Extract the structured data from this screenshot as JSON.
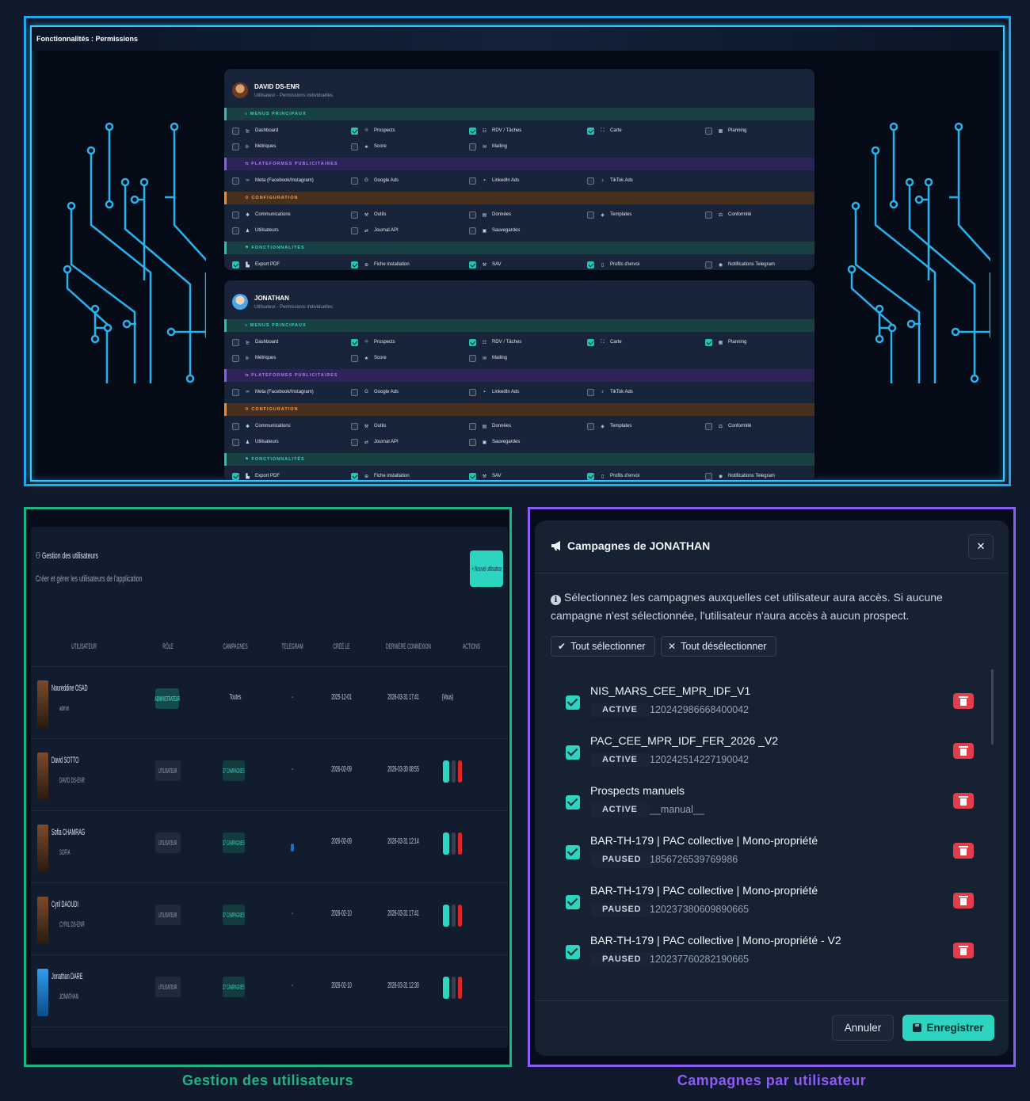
{
  "top": {
    "title": "Fonctionnalités : Permissions",
    "cards": [
      {
        "name": "DAVID DS-ENR",
        "subtitle": "Utilisateur - Permissions individuelles",
        "sections": [
          {
            "label": "≡  MENUS PRINCIPAUX",
            "color": "teal",
            "rows": [
              [
                {
                  "icon": "⊵",
                  "label": "Dashboard",
                  "checked": false
                },
                {
                  "icon": "⛗",
                  "label": "Prospects",
                  "checked": true
                },
                {
                  "icon": "☷",
                  "label": "RDV / Tâches",
                  "checked": true
                },
                {
                  "icon": "⛶",
                  "label": "Carte",
                  "checked": true
                },
                {
                  "icon": "▦",
                  "label": "Planning",
                  "checked": false
                }
              ],
              [
                {
                  "icon": "⊪",
                  "label": "Métriques",
                  "checked": false
                },
                {
                  "icon": "★",
                  "label": "Score",
                  "checked": false
                },
                {
                  "icon": "✉",
                  "label": "Mailing",
                  "checked": false
                }
              ]
            ]
          },
          {
            "label": "⇆  PLATEFORMES PUBLICITAIRES",
            "color": "purple",
            "rows": [
              [
                {
                  "icon": "∞",
                  "label": "Meta (Facebook/Instagram)",
                  "checked": false
                },
                {
                  "icon": "G",
                  "label": "Google Ads",
                  "checked": false
                },
                {
                  "icon": "▪",
                  "label": "LinkedIn Ads",
                  "checked": false
                },
                {
                  "icon": "♪",
                  "label": "TikTok Ads",
                  "checked": false
                }
              ]
            ]
          },
          {
            "label": "⚙  CONFIGURATION",
            "color": "orange",
            "rows": [
              [
                {
                  "icon": "✱",
                  "label": "Communications",
                  "checked": false
                },
                {
                  "icon": "⚒",
                  "label": "Outils",
                  "checked": false
                },
                {
                  "icon": "▤",
                  "label": "Données",
                  "checked": false
                },
                {
                  "icon": "◈",
                  "label": "Templates",
                  "checked": false
                },
                {
                  "icon": "⚖",
                  "label": "Conformité",
                  "checked": false
                }
              ],
              [
                {
                  "icon": "♟",
                  "label": "Utilisateurs",
                  "checked": false
                },
                {
                  "icon": "⇄",
                  "label": "Journal API",
                  "checked": false
                },
                {
                  "icon": "▣",
                  "label": "Sauvegardes",
                  "checked": false
                }
              ]
            ]
          },
          {
            "label": "⚑  FONCTIONNALITÉS",
            "color": "teal",
            "rows": [
              [
                {
                  "icon": "▙",
                  "label": "Export PDF",
                  "checked": true
                },
                {
                  "icon": "⊕",
                  "label": "Fiche installation",
                  "checked": true
                },
                {
                  "icon": "⚒",
                  "label": "SAV",
                  "checked": true
                },
                {
                  "icon": "▯",
                  "label": "Profils d'envoi",
                  "checked": true
                },
                {
                  "icon": "◉",
                  "label": "Notifications Telegram",
                  "checked": false
                }
              ]
            ]
          }
        ]
      },
      {
        "name": "JONATHAN",
        "subtitle": "Utilisateur - Permissions individuelles",
        "sections": [
          {
            "label": "≡  MENUS PRINCIPAUX",
            "color": "teal",
            "rows": [
              [
                {
                  "icon": "⊵",
                  "label": "Dashboard",
                  "checked": false
                },
                {
                  "icon": "⛗",
                  "label": "Prospects",
                  "checked": true
                },
                {
                  "icon": "☷",
                  "label": "RDV / Tâches",
                  "checked": true
                },
                {
                  "icon": "⛶",
                  "label": "Carte",
                  "checked": true
                },
                {
                  "icon": "▦",
                  "label": "Planning",
                  "checked": true
                }
              ],
              [
                {
                  "icon": "⊪",
                  "label": "Métriques",
                  "checked": false
                },
                {
                  "icon": "★",
                  "label": "Score",
                  "checked": false
                },
                {
                  "icon": "✉",
                  "label": "Mailing",
                  "checked": false
                }
              ]
            ]
          },
          {
            "label": "⇆  PLATEFORMES PUBLICITAIRES",
            "color": "purple",
            "rows": [
              [
                {
                  "icon": "∞",
                  "label": "Meta (Facebook/Instagram)",
                  "checked": false
                },
                {
                  "icon": "G",
                  "label": "Google Ads",
                  "checked": false
                },
                {
                  "icon": "▪",
                  "label": "LinkedIn Ads",
                  "checked": false
                },
                {
                  "icon": "♪",
                  "label": "TikTok Ads",
                  "checked": false
                }
              ]
            ]
          },
          {
            "label": "⚙  CONFIGURATION",
            "color": "orange",
            "rows": [
              [
                {
                  "icon": "✱",
                  "label": "Communications",
                  "checked": false
                },
                {
                  "icon": "⚒",
                  "label": "Outils",
                  "checked": false
                },
                {
                  "icon": "▤",
                  "label": "Données",
                  "checked": false
                },
                {
                  "icon": "◈",
                  "label": "Templates",
                  "checked": false
                },
                {
                  "icon": "⚖",
                  "label": "Conformité",
                  "checked": false
                }
              ],
              [
                {
                  "icon": "♟",
                  "label": "Utilisateurs",
                  "checked": false
                },
                {
                  "icon": "⇄",
                  "label": "Journal API",
                  "checked": false
                },
                {
                  "icon": "▣",
                  "label": "Sauvegardes",
                  "checked": false
                }
              ]
            ]
          },
          {
            "label": "⚑  FONCTIONNALITÉS",
            "color": "teal",
            "rows": [
              [
                {
                  "icon": "▙",
                  "label": "Export PDF",
                  "checked": true
                },
                {
                  "icon": "⊕",
                  "label": "Fiche installation",
                  "checked": true
                },
                {
                  "icon": "⚒",
                  "label": "SAV",
                  "checked": true
                },
                {
                  "icon": "▯",
                  "label": "Profils d'envoi",
                  "checked": true
                },
                {
                  "icon": "◉",
                  "label": "Notifications Telegram",
                  "checked": false
                }
              ]
            ]
          }
        ]
      }
    ]
  },
  "users": {
    "title": "⚇ Gestion des utilisateurs",
    "subtitle": "Créer et gérer les utilisateurs de l'application",
    "add_label": "+ Nouvel utilisateur",
    "columns": [
      "UTILISATEUR",
      "RÔLE",
      "CAMPAGNES",
      "TELEGRAM",
      "CRÉÉ LE",
      "DERNIÈRE CONNEXION",
      "ACTIONS"
    ],
    "rows": [
      {
        "name": "Noureddine OSAD",
        "company": "admin",
        "role": "ADMINISTRATEUR",
        "campaigns": "Toutes",
        "telegram": "-",
        "created": "2025-12-01",
        "last_login": "2026-03-31 17:41",
        "actions": "(Vous)",
        "avatar": "brown"
      },
      {
        "name": "David SOTTO",
        "company": "DAVID DS-ENR",
        "role": "UTILISATEUR",
        "campaigns": "37 CAMPAGNES",
        "telegram": "-",
        "created": "2026-02-09",
        "last_login": "2026-03-30 08:55",
        "avatar": "brown"
      },
      {
        "name": "Sofia CHAMRAG",
        "company": "SOFIA",
        "role": "UTILISATEUR",
        "campaigns": "37 CAMPAGNES",
        "telegram": "●",
        "created": "2026-02-09",
        "last_login": "2026-03-31 12:14",
        "avatar": "brown"
      },
      {
        "name": "Cyril DAOUDI",
        "company": "CYRIL DS-ENR",
        "role": "UTILISATEUR",
        "campaigns": "37 CAMPAGNES",
        "telegram": "-",
        "created": "2026-02-10",
        "last_login": "2026-03-31 17:41",
        "avatar": "brown"
      },
      {
        "name": "Jonathan DARE",
        "company": "JONATHAN",
        "role": "UTILISATEUR",
        "campaigns": "37 CAMPAGNES",
        "telegram": "-",
        "created": "2026-02-10",
        "last_login": "2026-03-31 12:30",
        "avatar": "blue"
      }
    ]
  },
  "modal": {
    "title": "Campagnes de JONATHAN",
    "info": "Sélectionnez les campagnes auxquelles cet utilisateur aura accès. Si aucune campagne n'est sélectionnée, l'utilisateur n'aura accès à aucun prospect.",
    "select_all": "Tout sélectionner",
    "deselect_all": "Tout désélectionner",
    "campaigns": [
      {
        "name": "NIS_MARS_CEE_MPR_IDF_V1",
        "status": "ACTIVE",
        "id": "120242986668400042"
      },
      {
        "name": "PAC_CEE_MPR_IDF_FER_2026 _V2",
        "status": "ACTIVE",
        "id": "120242514227190042"
      },
      {
        "name": "Prospects manuels",
        "status": "ACTIVE",
        "id": "__manual__"
      },
      {
        "name": "BAR-TH-179 | PAC collective | Mono-propriété",
        "status": "PAUSED",
        "id": "1856726539769986"
      },
      {
        "name": "BAR-TH-179 | PAC collective | Mono-propriété",
        "status": "PAUSED",
        "id": "120237380609890665"
      },
      {
        "name": "BAR-TH-179 | PAC collective | Mono-propriété - V2",
        "status": "PAUSED",
        "id": "120237760282190665"
      }
    ],
    "cancel": "Annuler",
    "save": "Enregistrer",
    "close": "✕"
  },
  "captions": {
    "left": "Gestion des utilisateurs",
    "right": "Campagnes par utilisateur"
  },
  "colors": {
    "top_border": "#1ba9ef",
    "left_border": "#1eb584",
    "right_border": "#8b5cf6",
    "accent": "#2dd4bf",
    "danger": "#e23d4a"
  }
}
